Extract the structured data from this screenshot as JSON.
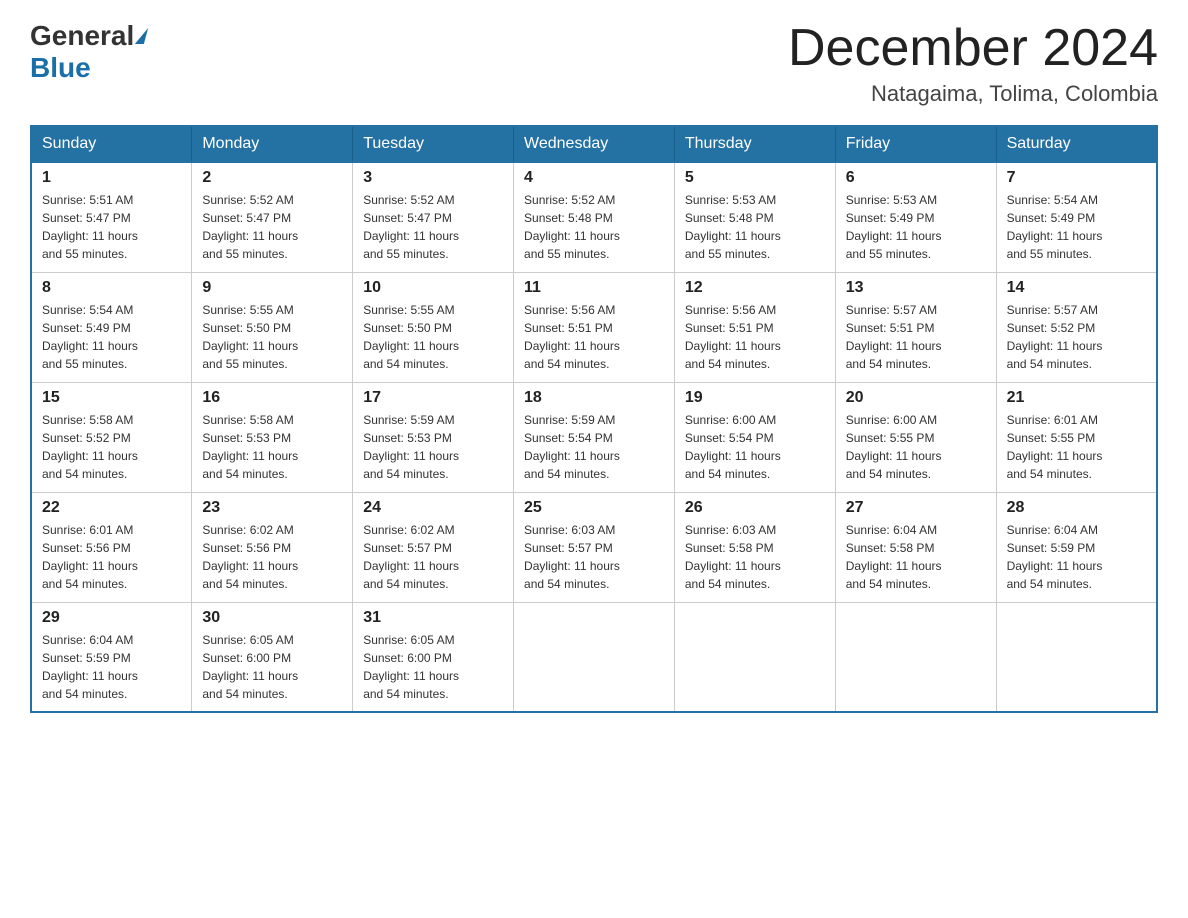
{
  "header": {
    "logo": {
      "general": "General",
      "blue": "Blue",
      "triangle": "▶"
    },
    "title": "December 2024",
    "location": "Natagaima, Tolima, Colombia"
  },
  "days_of_week": [
    "Sunday",
    "Monday",
    "Tuesday",
    "Wednesday",
    "Thursday",
    "Friday",
    "Saturday"
  ],
  "weeks": [
    [
      {
        "day": "1",
        "sunrise": "Sunrise: 5:51 AM",
        "sunset": "Sunset: 5:47 PM",
        "daylight": "Daylight: 11 hours and 55 minutes."
      },
      {
        "day": "2",
        "sunrise": "Sunrise: 5:52 AM",
        "sunset": "Sunset: 5:47 PM",
        "daylight": "Daylight: 11 hours and 55 minutes."
      },
      {
        "day": "3",
        "sunrise": "Sunrise: 5:52 AM",
        "sunset": "Sunset: 5:47 PM",
        "daylight": "Daylight: 11 hours and 55 minutes."
      },
      {
        "day": "4",
        "sunrise": "Sunrise: 5:52 AM",
        "sunset": "Sunset: 5:48 PM",
        "daylight": "Daylight: 11 hours and 55 minutes."
      },
      {
        "day": "5",
        "sunrise": "Sunrise: 5:53 AM",
        "sunset": "Sunset: 5:48 PM",
        "daylight": "Daylight: 11 hours and 55 minutes."
      },
      {
        "day": "6",
        "sunrise": "Sunrise: 5:53 AM",
        "sunset": "Sunset: 5:49 PM",
        "daylight": "Daylight: 11 hours and 55 minutes."
      },
      {
        "day": "7",
        "sunrise": "Sunrise: 5:54 AM",
        "sunset": "Sunset: 5:49 PM",
        "daylight": "Daylight: 11 hours and 55 minutes."
      }
    ],
    [
      {
        "day": "8",
        "sunrise": "Sunrise: 5:54 AM",
        "sunset": "Sunset: 5:49 PM",
        "daylight": "Daylight: 11 hours and 55 minutes."
      },
      {
        "day": "9",
        "sunrise": "Sunrise: 5:55 AM",
        "sunset": "Sunset: 5:50 PM",
        "daylight": "Daylight: 11 hours and 55 minutes."
      },
      {
        "day": "10",
        "sunrise": "Sunrise: 5:55 AM",
        "sunset": "Sunset: 5:50 PM",
        "daylight": "Daylight: 11 hours and 54 minutes."
      },
      {
        "day": "11",
        "sunrise": "Sunrise: 5:56 AM",
        "sunset": "Sunset: 5:51 PM",
        "daylight": "Daylight: 11 hours and 54 minutes."
      },
      {
        "day": "12",
        "sunrise": "Sunrise: 5:56 AM",
        "sunset": "Sunset: 5:51 PM",
        "daylight": "Daylight: 11 hours and 54 minutes."
      },
      {
        "day": "13",
        "sunrise": "Sunrise: 5:57 AM",
        "sunset": "Sunset: 5:51 PM",
        "daylight": "Daylight: 11 hours and 54 minutes."
      },
      {
        "day": "14",
        "sunrise": "Sunrise: 5:57 AM",
        "sunset": "Sunset: 5:52 PM",
        "daylight": "Daylight: 11 hours and 54 minutes."
      }
    ],
    [
      {
        "day": "15",
        "sunrise": "Sunrise: 5:58 AM",
        "sunset": "Sunset: 5:52 PM",
        "daylight": "Daylight: 11 hours and 54 minutes."
      },
      {
        "day": "16",
        "sunrise": "Sunrise: 5:58 AM",
        "sunset": "Sunset: 5:53 PM",
        "daylight": "Daylight: 11 hours and 54 minutes."
      },
      {
        "day": "17",
        "sunrise": "Sunrise: 5:59 AM",
        "sunset": "Sunset: 5:53 PM",
        "daylight": "Daylight: 11 hours and 54 minutes."
      },
      {
        "day": "18",
        "sunrise": "Sunrise: 5:59 AM",
        "sunset": "Sunset: 5:54 PM",
        "daylight": "Daylight: 11 hours and 54 minutes."
      },
      {
        "day": "19",
        "sunrise": "Sunrise: 6:00 AM",
        "sunset": "Sunset: 5:54 PM",
        "daylight": "Daylight: 11 hours and 54 minutes."
      },
      {
        "day": "20",
        "sunrise": "Sunrise: 6:00 AM",
        "sunset": "Sunset: 5:55 PM",
        "daylight": "Daylight: 11 hours and 54 minutes."
      },
      {
        "day": "21",
        "sunrise": "Sunrise: 6:01 AM",
        "sunset": "Sunset: 5:55 PM",
        "daylight": "Daylight: 11 hours and 54 minutes."
      }
    ],
    [
      {
        "day": "22",
        "sunrise": "Sunrise: 6:01 AM",
        "sunset": "Sunset: 5:56 PM",
        "daylight": "Daylight: 11 hours and 54 minutes."
      },
      {
        "day": "23",
        "sunrise": "Sunrise: 6:02 AM",
        "sunset": "Sunset: 5:56 PM",
        "daylight": "Daylight: 11 hours and 54 minutes."
      },
      {
        "day": "24",
        "sunrise": "Sunrise: 6:02 AM",
        "sunset": "Sunset: 5:57 PM",
        "daylight": "Daylight: 11 hours and 54 minutes."
      },
      {
        "day": "25",
        "sunrise": "Sunrise: 6:03 AM",
        "sunset": "Sunset: 5:57 PM",
        "daylight": "Daylight: 11 hours and 54 minutes."
      },
      {
        "day": "26",
        "sunrise": "Sunrise: 6:03 AM",
        "sunset": "Sunset: 5:58 PM",
        "daylight": "Daylight: 11 hours and 54 minutes."
      },
      {
        "day": "27",
        "sunrise": "Sunrise: 6:04 AM",
        "sunset": "Sunset: 5:58 PM",
        "daylight": "Daylight: 11 hours and 54 minutes."
      },
      {
        "day": "28",
        "sunrise": "Sunrise: 6:04 AM",
        "sunset": "Sunset: 5:59 PM",
        "daylight": "Daylight: 11 hours and 54 minutes."
      }
    ],
    [
      {
        "day": "29",
        "sunrise": "Sunrise: 6:04 AM",
        "sunset": "Sunset: 5:59 PM",
        "daylight": "Daylight: 11 hours and 54 minutes."
      },
      {
        "day": "30",
        "sunrise": "Sunrise: 6:05 AM",
        "sunset": "Sunset: 6:00 PM",
        "daylight": "Daylight: 11 hours and 54 minutes."
      },
      {
        "day": "31",
        "sunrise": "Sunrise: 6:05 AM",
        "sunset": "Sunset: 6:00 PM",
        "daylight": "Daylight: 11 hours and 54 minutes."
      },
      null,
      null,
      null,
      null
    ]
  ]
}
